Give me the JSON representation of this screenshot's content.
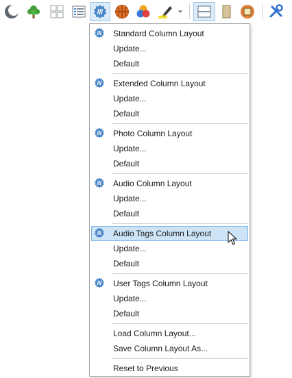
{
  "toolbar": {
    "buttons": [
      {
        "icon": "moon-icon"
      },
      {
        "icon": "tree-icon"
      },
      {
        "icon": "grid-icon"
      },
      {
        "icon": "details-view-icon"
      },
      {
        "icon": "column-layout-icon",
        "active": true
      },
      {
        "icon": "basketball-icon"
      },
      {
        "icon": "color-circles-icon"
      },
      {
        "icon": "highlighter-icon"
      },
      {
        "icon": "chevron-down-icon"
      },
      {
        "icon": "horizontal-split-icon",
        "active": true
      },
      {
        "icon": "preview-pane-icon"
      },
      {
        "icon": "frame-icon"
      },
      {
        "icon": "tools-icon"
      }
    ]
  },
  "menu": {
    "groups": [
      {
        "icon": "column-layout-icon",
        "items": [
          "Standard Column Layout",
          "Update...",
          "Default"
        ]
      },
      {
        "icon": "column-layout-icon",
        "items": [
          "Extended Column Layout",
          "Update...",
          "Default"
        ]
      },
      {
        "icon": "column-layout-icon",
        "items": [
          "Photo Column Layout",
          "Update...",
          "Default"
        ]
      },
      {
        "icon": "column-layout-icon",
        "items": [
          "Audio Column Layout",
          "Update...",
          "Default"
        ]
      },
      {
        "icon": "column-layout-icon",
        "highlighted": true,
        "items": [
          "Audio Tags Column Layout",
          "Update...",
          "Default"
        ]
      },
      {
        "icon": "column-layout-icon",
        "items": [
          "User Tags Column Layout",
          "Update...",
          "Default"
        ]
      }
    ],
    "file_items": [
      "Load Column Layout...",
      "Save Column Layout As..."
    ],
    "reset_item": "Reset to Previous"
  },
  "colors": {
    "accent": "#4a86c8",
    "highlight_bg": "#cde4f7",
    "highlight_border": "#7eb4ea"
  }
}
